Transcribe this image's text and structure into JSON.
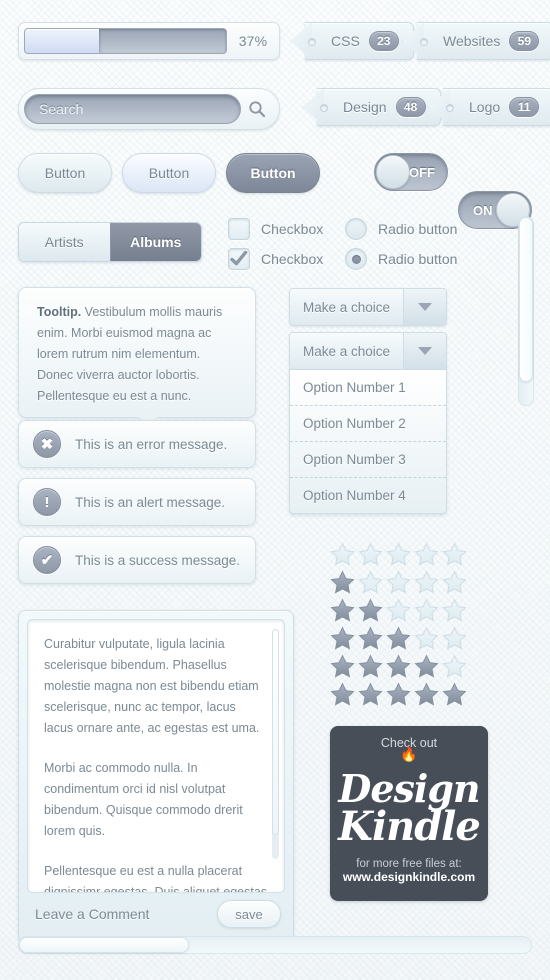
{
  "progress": {
    "percent_label": "37%",
    "percent_value": 37
  },
  "tags": [
    {
      "label": "CSS",
      "count": "23"
    },
    {
      "label": "Websites",
      "count": "59"
    },
    {
      "label": "Design",
      "count": "48"
    },
    {
      "label": "Logo",
      "count": "11"
    }
  ],
  "search": {
    "placeholder": "Search",
    "value": "Search",
    "icon": "search-icon"
  },
  "buttons": [
    {
      "label": "Button",
      "state": "default"
    },
    {
      "label": "Button",
      "state": "hover"
    },
    {
      "label": "Button",
      "state": "pressed"
    }
  ],
  "toggles": [
    {
      "label": "OFF",
      "state": "off"
    },
    {
      "label": "ON",
      "state": "on"
    }
  ],
  "segmented": {
    "items": [
      {
        "label": "Artists",
        "active": false
      },
      {
        "label": "Albums",
        "active": true
      }
    ]
  },
  "checkboxes": [
    {
      "label": "Checkbox",
      "checked": false
    },
    {
      "label": "Checkbox",
      "checked": true
    }
  ],
  "radios": [
    {
      "label": "Radio button",
      "selected": false
    },
    {
      "label": "Radio button",
      "selected": true
    }
  ],
  "tooltip": {
    "lead": "Tooltip.",
    "body": " Vestibulum mollis mauris enim. Morbi euismod magna ac lorem rutrum nim elementum. Donec viverra auctor lobortis. Pellentesque eu est a nunc."
  },
  "messages": [
    {
      "type": "error",
      "icon": "error-x-icon",
      "glyph": "✖",
      "text": "This is an error message."
    },
    {
      "type": "alert",
      "icon": "alert-exclamation-icon",
      "glyph": "!",
      "text": "This is an alert message."
    },
    {
      "type": "success",
      "icon": "success-check-icon",
      "glyph": "✔",
      "text": "This is a success message."
    }
  ],
  "select_closed": {
    "value": "Make a choice",
    "arrow_icon": "chevron-down-icon"
  },
  "select_open": {
    "value": "Make a choice",
    "arrow_icon": "chevron-down-icon",
    "options": [
      "Option Number 1",
      "Option Number 2",
      "Option Number 3",
      "Option Number 4"
    ]
  },
  "ratings": [
    {
      "filled": 0,
      "total": 5
    },
    {
      "filled": 1,
      "total": 5
    },
    {
      "filled": 2,
      "total": 5
    },
    {
      "filled": 3,
      "total": 5
    },
    {
      "filled": 4,
      "total": 5
    },
    {
      "filled": 5,
      "total": 5
    }
  ],
  "comment": {
    "paragraphs": [
      "Curabitur vulputate, ligula lacinia scelerisque bibendum. Phasellus molestie magna non est bibendu etiam scelerisque, nunc ac tempor, lacus lacus ornare ante, ac egestas est uma.",
      "Morbi ac commodo nulla. In condimentum orci id nisl volutpat bibendum. Quisque commodo drerit lorem quis.",
      "Pellentesque eu est a nulla placerat dignissimr egestas. Duis aliquet egestas purus elerisque tempor, lacus lacus ornare antac."
    ],
    "footer_label": "Leave a Comment",
    "save_label": "save"
  },
  "promo": {
    "top_line": "Check out",
    "logo_line1": "Design",
    "logo_line2": "Kindle",
    "bottom_line1": "for more free files at:",
    "bottom_line2": "www.designkindle.com"
  },
  "scrollbars": {
    "vertical": {
      "thumb_percent": 87
    },
    "horizontal": {
      "thumb_percent": 33
    }
  },
  "colors": {
    "background": "#f7f9fa",
    "text": "#7b8a94",
    "accent_dark": "#7d8797",
    "promo_bg": "#474e58",
    "progress_fill": "#dbe6f6"
  }
}
